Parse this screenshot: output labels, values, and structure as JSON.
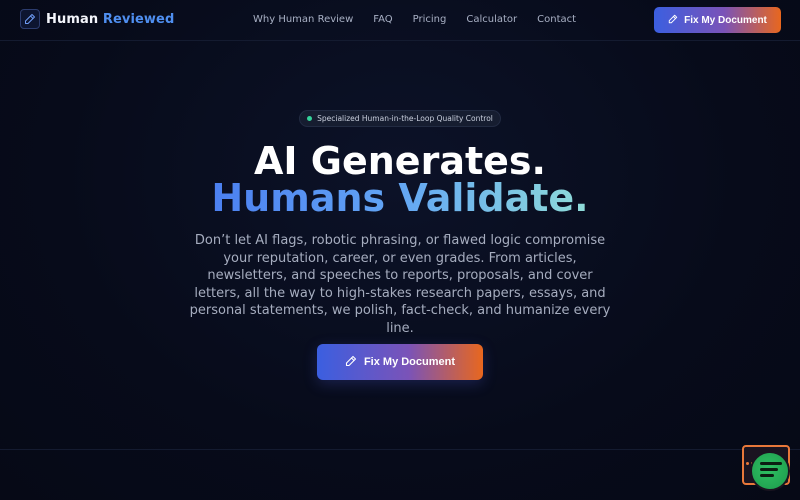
{
  "brand": {
    "name_part1": "Human",
    "name_part2": "Reviewed",
    "accent": "#4f8ff0"
  },
  "nav": {
    "items": [
      {
        "label": "Why Human Review"
      },
      {
        "label": "FAQ"
      },
      {
        "label": "Pricing"
      },
      {
        "label": "Calculator"
      },
      {
        "label": "Contact"
      }
    ]
  },
  "header": {
    "cta_label": "Fix My Document",
    "cta_icon": "pen-icon"
  },
  "hero": {
    "badge": "Specialized Human-in-the-Loop Quality Control",
    "badge_dot_color": "#34d39b",
    "title_line1": "AI Generates.",
    "title_line2": "Humans Validate.",
    "description": "Don’t let AI flags, robotic phrasing, or flawed logic compromise your reputation, career, or even grades. From articles, newsletters, and speeches to reports, proposals, and cover letters, all the way to high-stakes research papers, essays, and personal statements, we polish, fact-check, and humanize every line.",
    "cta_label": "Fix My Document",
    "cta_gradient": [
      "#3b5fe0",
      "#7a53b8",
      "#e8671e"
    ]
  },
  "widget": {
    "icon": "chat-widget-icon"
  }
}
